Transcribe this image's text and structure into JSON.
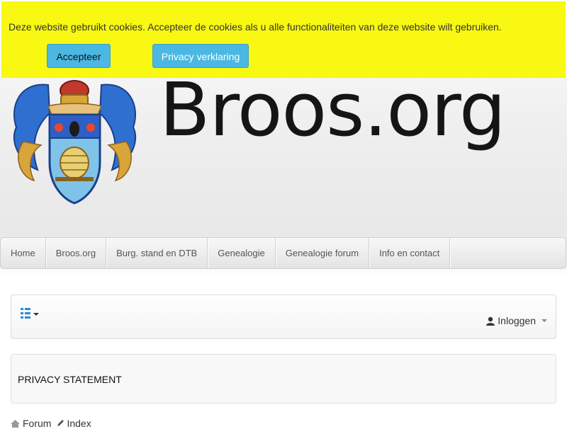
{
  "cookie_bar": {
    "message": "Deze website gebruikt cookies. Accepteer de cookies als u alle functionaliteiten van deze website wilt gebruiken.",
    "accept_label": "Accepteer",
    "privacy_label": "Privacy verklaring",
    "background": "#f8f812",
    "button_color": "#4ab8e2"
  },
  "header": {
    "title": "Broos.org",
    "logo": "coat-of-arms"
  },
  "nav": {
    "items": [
      {
        "label": "Home"
      },
      {
        "label": "Broos.org"
      },
      {
        "label": "Burg. stand en DTB"
      },
      {
        "label": "Genealogie"
      },
      {
        "label": "Genealogie forum"
      },
      {
        "label": "Info en contact"
      }
    ]
  },
  "toolbar": {
    "menu_icon": "list-icon",
    "login_label": "Inloggen",
    "login_icon": "user-icon"
  },
  "content": {
    "heading": "PRIVACY STATEMENT"
  },
  "breadcrumb": {
    "items": [
      "Forum",
      "Index"
    ]
  }
}
